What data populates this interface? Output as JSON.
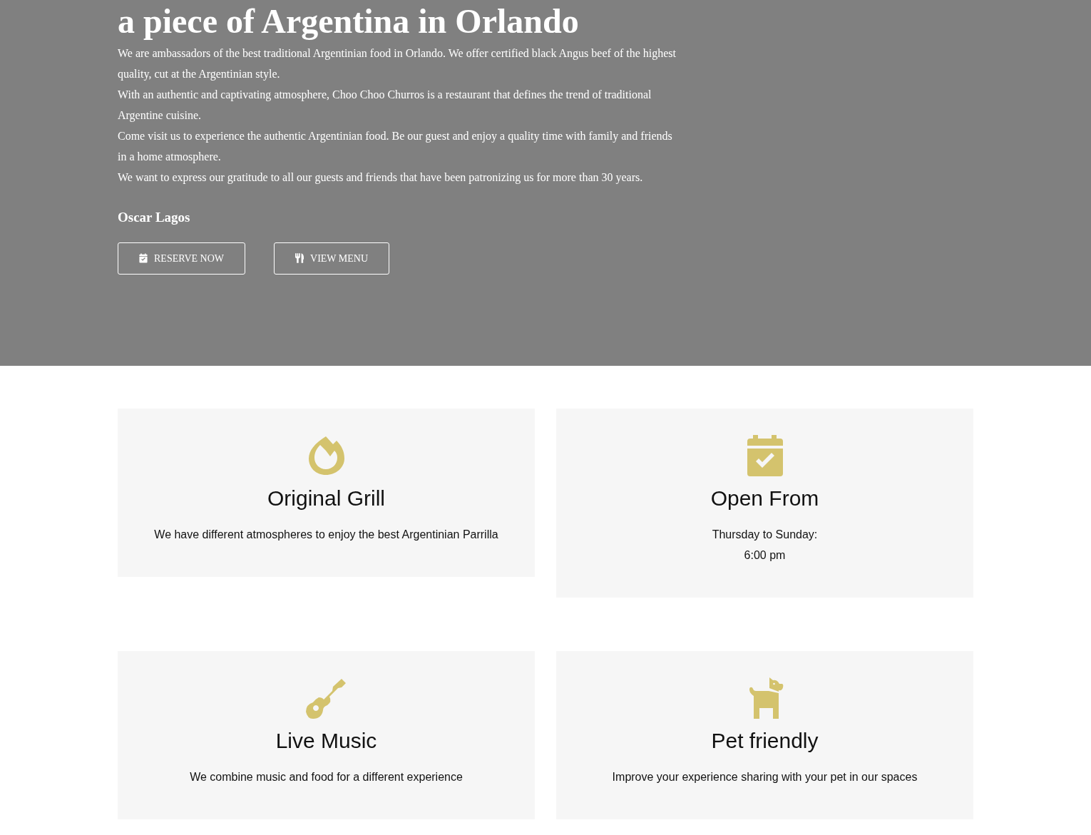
{
  "hero": {
    "heading": "a piece of Argentina in Orlando",
    "paragraphs": [
      "We are ambassadors of the best traditional Argentinian food in Orlando. We offer certified black Angus beef of the highest quality, cut at the Argentinian style.",
      "With an authentic and captivating atmosphere, Choo Choo Churros is a restaurant that defines the trend of traditional Argentine cuisine.",
      "Come visit us to experience the authentic Argentinian food. Be our guest and enjoy a quality time with family and friends in a home atmosphere.",
      "We want to express our gratitude to all our guests and friends that have been patronizing us for more than 30 years."
    ],
    "signature": "Oscar Lagos",
    "buttons": [
      {
        "label": "RESERVE NOW"
      },
      {
        "label": "VIEW MENU"
      }
    ]
  },
  "features": [
    {
      "title": "Original Grill",
      "lines": [
        "We have different atmospheres to enjoy the best Argentinian Parrilla"
      ]
    },
    {
      "title": "Open From",
      "lines": [
        "Thursday to Sunday:",
        "6:00 pm"
      ]
    },
    {
      "title": "Live Music",
      "lines": [
        "We combine music and food for a different experience"
      ]
    },
    {
      "title": "Pet friendly",
      "lines": [
        "Improve your experience sharing with your pet in our spaces"
      ]
    }
  ]
}
